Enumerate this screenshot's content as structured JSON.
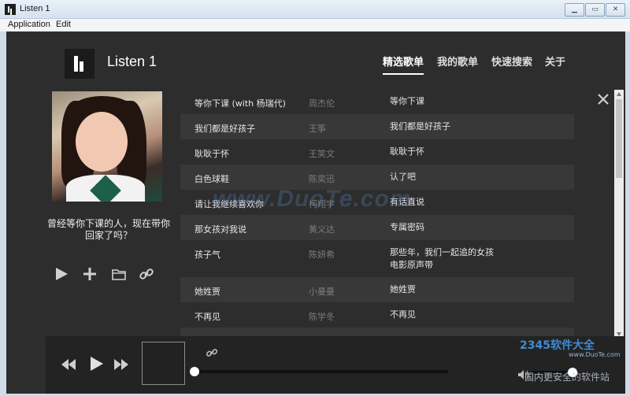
{
  "window": {
    "title": "Listen 1"
  },
  "menubar": {
    "items": [
      "Application",
      "Edit"
    ]
  },
  "header": {
    "brand": "Listen 1",
    "nav": [
      "精选歌单",
      "我的歌单",
      "快速搜索",
      "关于"
    ],
    "active_nav": "精选歌单"
  },
  "playlist": {
    "caption": "曾经等你下课的人，现在带你回家了吗？"
  },
  "songs": [
    {
      "title": "等你下课 (with 杨瑞代)",
      "artist": "周杰伦",
      "album": "等你下课"
    },
    {
      "title": "我们都是好孩子",
      "artist": "王筝",
      "album": "我们都是好孩子"
    },
    {
      "title": "耿耿于怀",
      "artist": "王笑文",
      "album": "耿耿于怀"
    },
    {
      "title": "白色球鞋",
      "artist": "陈奕迅",
      "album": "认了吧"
    },
    {
      "title": "请让我继续喜欢你",
      "artist": "柯翔宇",
      "album": "有话直说"
    },
    {
      "title": "那女孩对我说",
      "artist": "黄义达",
      "album": "专属密码"
    },
    {
      "title": "孩子气",
      "artist": "陈妍希",
      "album": "那些年，我们一起追的女孩 电影原声带"
    },
    {
      "title": "她姓贾",
      "artist": "小曼曼",
      "album": "她姓贾"
    },
    {
      "title": "不再见",
      "artist": "陈学冬",
      "album": "不再见"
    }
  ],
  "watermark": {
    "main": "www.DuoTe.com",
    "corner": "国内更安全的软件站",
    "logo": "2345软件大全",
    "url": "www.DuoTe.com"
  },
  "player": {
    "progress": 0.0,
    "volume": 1.0
  },
  "colors": {
    "app_bg": "#2d2d2d",
    "row_alt": "#383838",
    "player_bg": "#232323",
    "artist_text": "#7c7c7c"
  }
}
